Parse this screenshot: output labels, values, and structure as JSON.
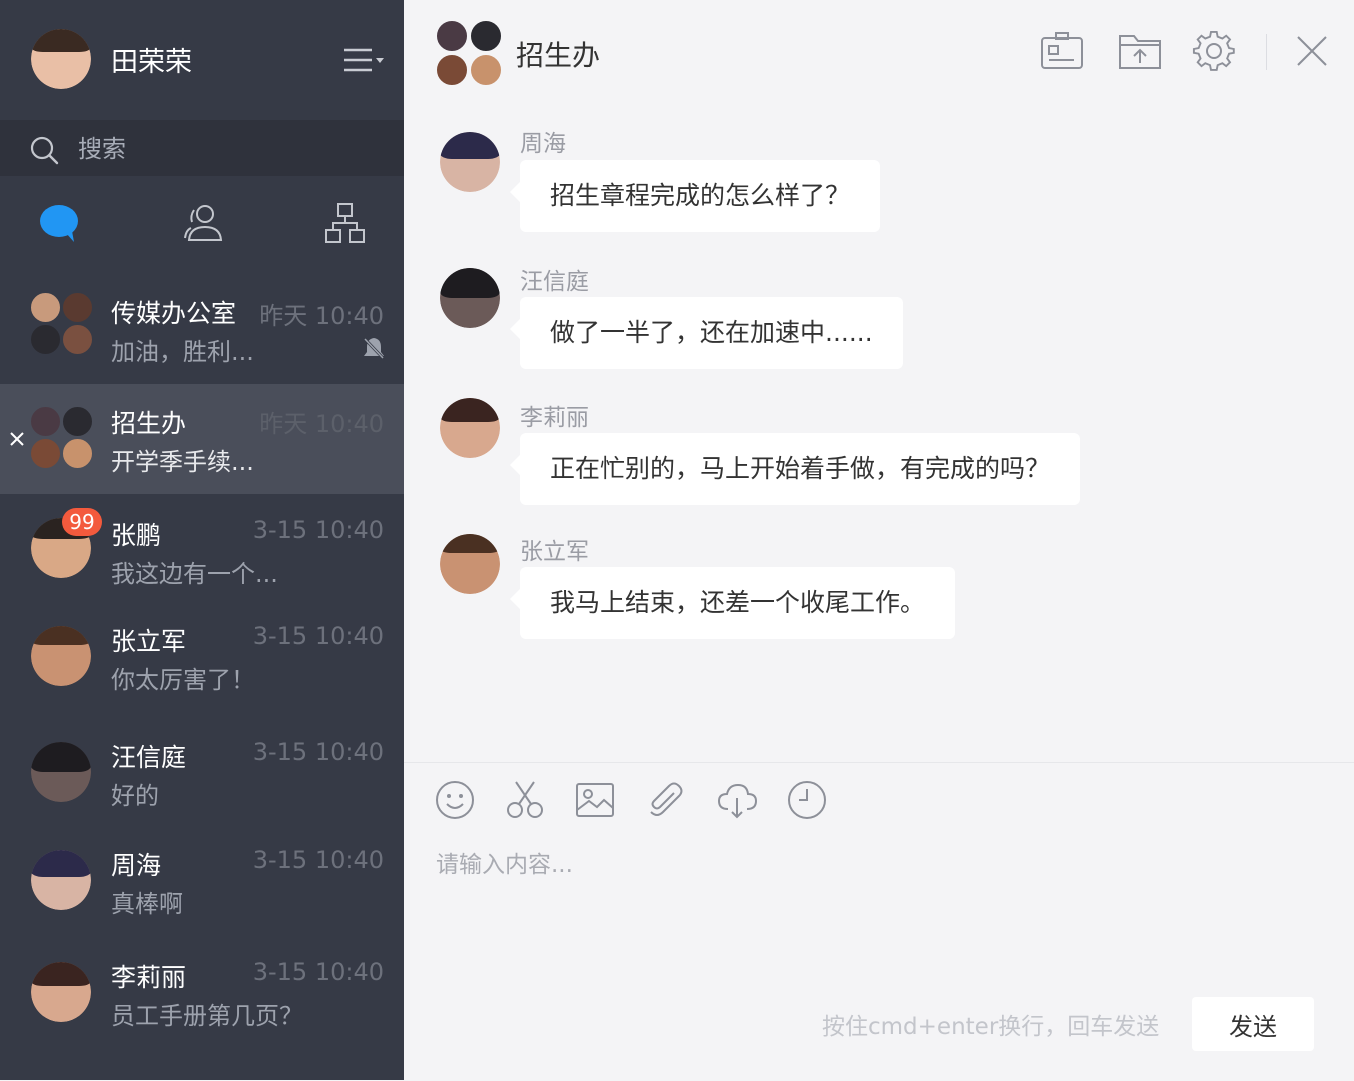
{
  "me": {
    "name": "田荣荣"
  },
  "search": {
    "placeholder": "搜索"
  },
  "icons": {
    "menu": "menu-icon",
    "tabs": [
      "chat-bubble-icon",
      "contacts-icon",
      "org-chart-icon"
    ]
  },
  "conversations": [
    {
      "name": "传媒办公室",
      "message": "加油，胜利...",
      "time": "昨天 10:40",
      "muted": true
    },
    {
      "name": "招生办",
      "message": "开学季手续...",
      "time": "昨天 10:40",
      "active": true
    },
    {
      "name": "张鹏",
      "message": "我这边有一个...",
      "time": "3-15 10:40",
      "badge": "99"
    },
    {
      "name": "张立军",
      "message": "你太厉害了！",
      "time": "3-15 10:40"
    },
    {
      "name": "汪信庭",
      "message": "好的",
      "time": "3-15 10:40"
    },
    {
      "name": "周海",
      "message": "真棒啊",
      "time": "3-15 10:40"
    },
    {
      "name": "李莉丽",
      "message": "员工手册第几页？",
      "time": "3-15 10:40"
    }
  ],
  "chat": {
    "title": "招生办",
    "header_icons": [
      "id-card-icon",
      "folder-upload-icon",
      "settings-icon",
      "close-icon"
    ],
    "messages": [
      {
        "sender": "周海",
        "text": "招生章程完成的怎么样了？"
      },
      {
        "sender": "汪信庭",
        "text": "做了一半了，还在加速中......"
      },
      {
        "sender": "李莉丽",
        "text": "正在忙别的，马上开始着手做，有完成的吗？"
      },
      {
        "sender": "张立军",
        "text": "我马上结束，还差一个收尾工作。"
      }
    ]
  },
  "composer": {
    "tools": [
      "emoji-icon",
      "scissors-icon",
      "image-icon",
      "paperclip-icon",
      "cloud-download-icon",
      "clock-icon"
    ],
    "placeholder": "请输入内容...",
    "hint": "按住cmd+enter换行，回车发送",
    "send_label": "发送"
  },
  "colors": {
    "sidebar_bg": "#363a46",
    "active_row": "#4a4e5a",
    "accent_blue": "#2196f3",
    "badge_red": "#f35a3d"
  }
}
